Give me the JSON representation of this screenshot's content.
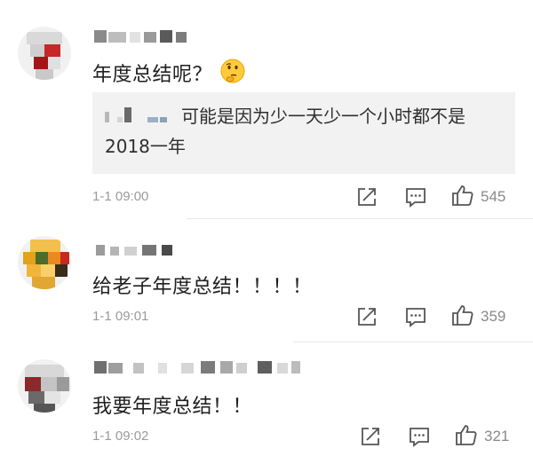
{
  "comments": [
    {
      "text": "年度总结呢？",
      "emoji": "thinking-face-icon",
      "quote": {
        "text": "可能是因为少一天少一个小时都不是2018一年"
      },
      "time": "1-1 09:00",
      "likes": "545"
    },
    {
      "text": "给老子年度总结！！！！",
      "time": "1-1 09:01",
      "likes": "359"
    },
    {
      "text": "我要年度总结！！",
      "time": "1-1 09:02",
      "likes": "321"
    }
  ],
  "icons": {
    "share": "share-icon",
    "comment": "comment-icon",
    "like": "thumbs-up-icon"
  }
}
